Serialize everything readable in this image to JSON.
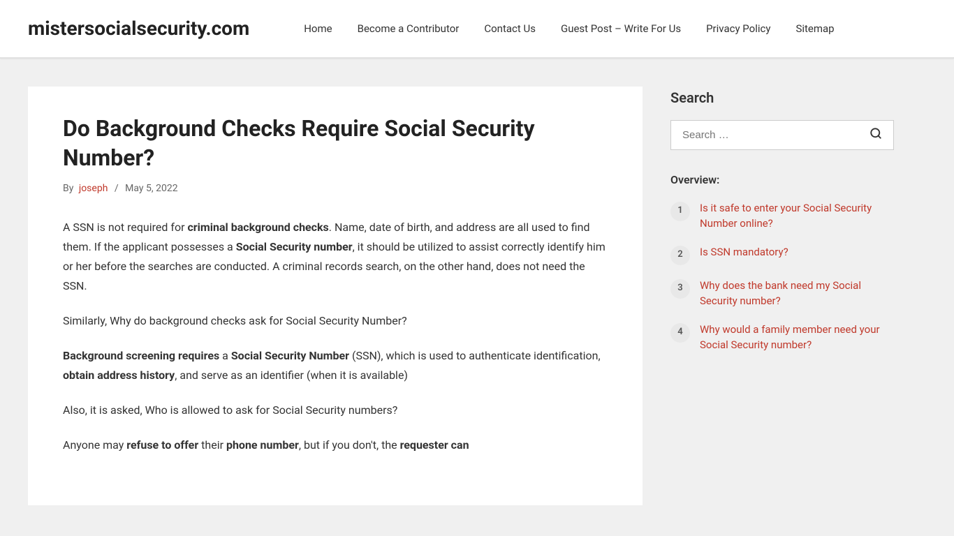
{
  "site": {
    "title": "mistersocialsecurity.com"
  },
  "nav": {
    "items": [
      {
        "label": "Home",
        "href": "#"
      },
      {
        "label": "Become a Contributor",
        "href": "#"
      },
      {
        "label": "Contact Us",
        "href": "#"
      },
      {
        "label": "Guest Post – Write For Us",
        "href": "#"
      },
      {
        "label": "Privacy Policy",
        "href": "#"
      },
      {
        "label": "Sitemap",
        "href": "#"
      }
    ]
  },
  "article": {
    "title": "Do Background Checks Require Social Security Number?",
    "meta": {
      "prefix": "By",
      "author": "joseph",
      "separator": "/",
      "date": "May 5, 2022"
    },
    "paragraphs": [
      {
        "id": "p1",
        "html": "A SSN is not required for <strong>criminal background checks</strong>. Name, date of birth, and address are all used to find them. If the applicant possesses a <strong>Social Security number</strong>, it should be utilized to assist correctly identify him or her before the searches are conducted. A criminal records search, on the other hand, does not need the SSN."
      },
      {
        "id": "p2",
        "html": "Similarly, Why do background checks ask for Social Security Number?"
      },
      {
        "id": "p3",
        "html": "<strong>Background screening requires</strong> a <strong>Social Security Number</strong> (SSN), which is used to authenticate identification, <strong>obtain address history</strong>, and serve as an identifier (when it is available)"
      },
      {
        "id": "p4",
        "html": "Also, it is asked, Who is allowed to ask for Social Security numbers?"
      },
      {
        "id": "p5",
        "html": "Anyone may <strong>refuse to offer</strong> their <strong>phone number</strong>, but if you don't, the <strong>requester can</strong>"
      }
    ]
  },
  "sidebar": {
    "search": {
      "title": "Search",
      "placeholder": "Search …",
      "button_label": "🔍"
    },
    "overview": {
      "label": "Overview:",
      "items": [
        {
          "number": "1",
          "text": "Is it safe to enter your Social Security Number online?"
        },
        {
          "number": "2",
          "text": "Is SSN mandatory?"
        },
        {
          "number": "3",
          "text": "Why does the bank need my Social Security number?"
        },
        {
          "number": "4",
          "text": "Why would a family member need your Social Security number?"
        }
      ]
    }
  }
}
